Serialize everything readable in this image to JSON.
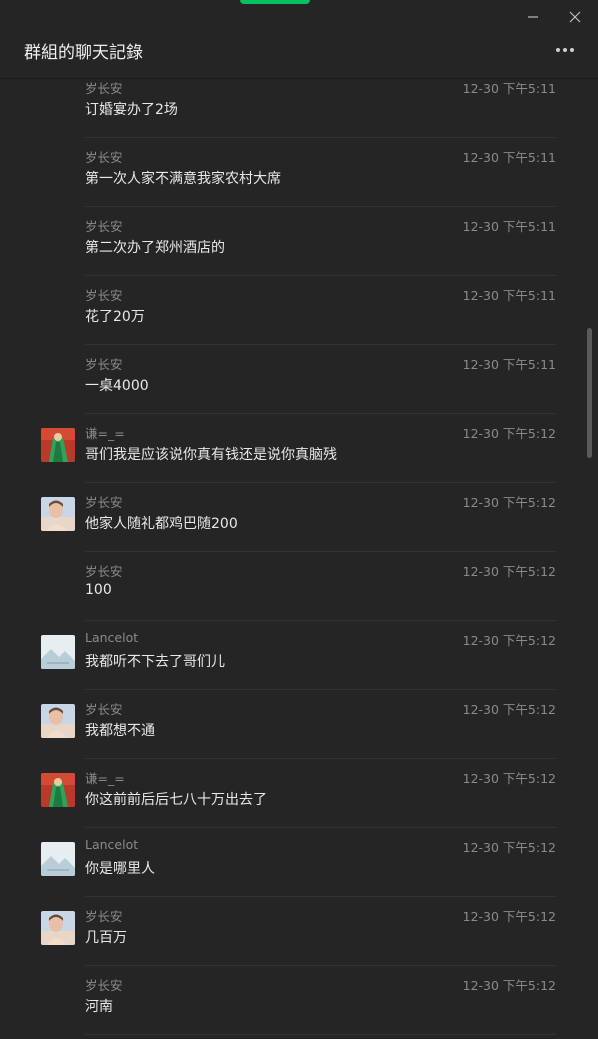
{
  "window": {
    "title": "群組的聊天記錄"
  },
  "messages": [
    {
      "sender": "岁长安",
      "time": "12-30 下午5:11",
      "text": "订婚宴办了2场",
      "avatar": "none"
    },
    {
      "sender": "岁长安",
      "time": "12-30 下午5:11",
      "text": "第一次人家不满意我家农村大席",
      "avatar": "none"
    },
    {
      "sender": "岁长安",
      "time": "12-30 下午5:11",
      "text": "第二次办了郑州酒店的",
      "avatar": "none"
    },
    {
      "sender": "岁长安",
      "time": "12-30 下午5:11",
      "text": "花了20万",
      "avatar": "none"
    },
    {
      "sender": "岁长安",
      "time": "12-30 下午5:11",
      "text": "一桌4000",
      "avatar": "none"
    },
    {
      "sender": "谦=_=",
      "time": "12-30 下午5:12",
      "text": "哥们我是应该说你真有钱还是说你真脑残",
      "avatar": "green"
    },
    {
      "sender": "岁长安",
      "time": "12-30 下午5:12",
      "text": "他家人随礼都鸡巴随200",
      "avatar": "portrait"
    },
    {
      "sender": "岁长安",
      "time": "12-30 下午5:12",
      "text": "100",
      "avatar": "none"
    },
    {
      "sender": "Lancelot",
      "time": "12-30 下午5:12",
      "text": "我都听不下去了哥们儿",
      "avatar": "landscape"
    },
    {
      "sender": "岁长安",
      "time": "12-30 下午5:12",
      "text": "我都想不通",
      "avatar": "portrait"
    },
    {
      "sender": "谦=_=",
      "time": "12-30 下午5:12",
      "text": "你这前前后后七八十万出去了",
      "avatar": "green"
    },
    {
      "sender": "Lancelot",
      "time": "12-30 下午5:12",
      "text": "你是哪里人",
      "avatar": "landscape"
    },
    {
      "sender": "岁长安",
      "time": "12-30 下午5:12",
      "text": "几百万",
      "avatar": "portrait"
    },
    {
      "sender": "岁长安",
      "time": "12-30 下午5:12",
      "text": "河南",
      "avatar": "none"
    }
  ],
  "icons": {
    "minimize": "minimize-icon",
    "close": "close-icon",
    "more": "more-dots-icon"
  },
  "colors": {
    "background": "#252525",
    "accent": "#07c160",
    "secondary_text": "#8a8a8a"
  }
}
